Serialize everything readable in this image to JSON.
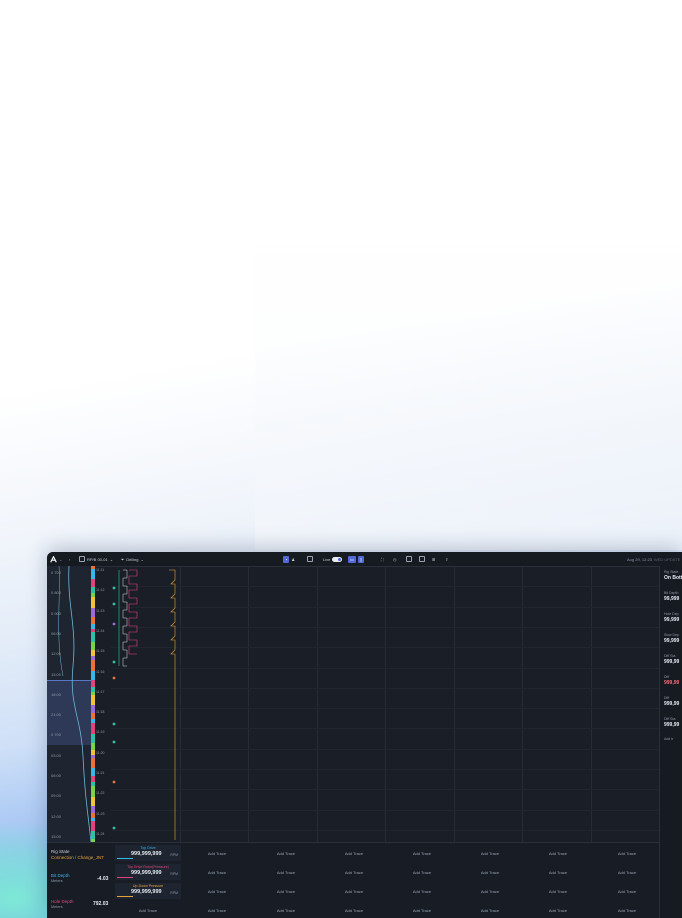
{
  "toolbar": {
    "well": "RP/B 00-01",
    "mode": "Drilling",
    "live_label": "Live",
    "timestamp": "Aug 29, 12:23",
    "status": "WED UPDATE"
  },
  "depth_labels": [
    "0 700",
    "0 800",
    "0 900",
    "06:00",
    "12:00",
    "15:00",
    "18:00",
    "21:00",
    "0 700",
    "03:00",
    "06:00",
    "09:00",
    "12:00",
    "15:00"
  ],
  "time_labels": [
    "11:11",
    "11:12",
    "11:13",
    "11:14",
    "11:15",
    "11:16",
    "11:17",
    "11:18",
    "11:19",
    "11:20",
    "11:21",
    "11:22",
    "11:23",
    "11:24"
  ],
  "right_panel": [
    {
      "label": "Rig State",
      "value": "On Bott"
    },
    {
      "label": "Bit Depth",
      "value": "99,999"
    },
    {
      "label": "Hole Dep",
      "value": "99,999"
    },
    {
      "label": "Slow Dep",
      "value": "99,999"
    },
    {
      "label": "Diff Sta",
      "value": "999,99"
    },
    {
      "label": "Diff",
      "value": "999,99"
    },
    {
      "label": "Diff",
      "value": "999,99"
    },
    {
      "label": "Diff Sta",
      "value": "999,99"
    }
  ],
  "right_add": "Add tr",
  "bottom_left": {
    "rig_state_label": "Rig State",
    "rig_state_value": "Connection / Change_JNT",
    "bit_depth_label": "Bit Depth",
    "bit_depth_unit": "Meters",
    "bit_depth_value": "-4.03",
    "hole_depth_label": "Hole Depth",
    "hole_depth_unit": "Meters",
    "hole_depth_value": "792.03"
  },
  "trace_cards": [
    {
      "name": "Top Drive",
      "value": "999,999,999",
      "unit": "RPM",
      "color": "#38b6e8"
    },
    {
      "name": "Top Drive Rotor(Pressure)",
      "value": "999,999,999",
      "unit": "RPM",
      "color": "#e0447a"
    },
    {
      "name": "Up-Down Pressure",
      "value": "999,999,999",
      "unit": "RPM",
      "color": "#e8a23a"
    }
  ],
  "add_trace": "Add Trace",
  "colors": {
    "accent": "#5468d8",
    "trace_pink": "#e0447a",
    "trace_orange": "#e8a23a",
    "trace_teal": "#2fc1a6"
  }
}
